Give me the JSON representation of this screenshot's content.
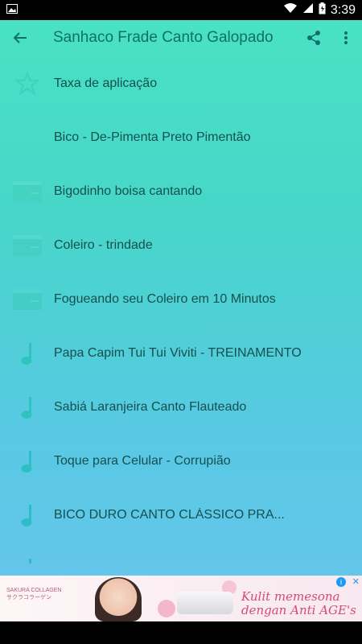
{
  "status_bar": {
    "time": "3:39"
  },
  "toolbar": {
    "title": "Sanhaco Frade Canto Galopado"
  },
  "list": {
    "items": [
      {
        "label": "Taxa de aplicação",
        "icon": "star-outline-icon"
      },
      {
        "label": "Bico - De-Pimenta Preto Pimentão",
        "icon": "none"
      },
      {
        "label": "Bigodinho boisa cantando",
        "icon": "video-icon"
      },
      {
        "label": "Coleiro - trindade",
        "icon": "video-icon"
      },
      {
        "label": "Fogueando seu Coleiro em 10 Minutos",
        "icon": "video-icon"
      },
      {
        "label": "Papa Capim Tui Tui Viviti - TREINAMENTO",
        "icon": "music-note-icon"
      },
      {
        "label": "Sabiá Laranjeira Canto Flauteado",
        "icon": "music-note-icon"
      },
      {
        "label": "Toque para Celular - Corrupião",
        "icon": "music-note-icon"
      },
      {
        "label": "BICO DURO CANTO CLÁSSICO PRA...",
        "icon": "music-note-icon"
      }
    ]
  },
  "ad": {
    "brand_line1": "SAKURA COLLAGEN",
    "brand_line2": "サクラコラーゲン",
    "text_line1": "Kulit memesona",
    "text_line2": "dengan Anti AGE's"
  },
  "colors": {
    "accent": "#49e2c4",
    "text": "#14504e",
    "icon": "#2fc6b4"
  }
}
